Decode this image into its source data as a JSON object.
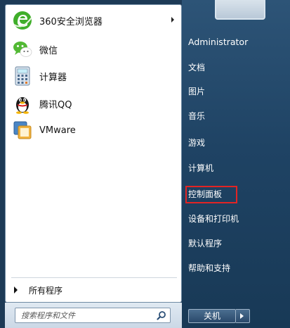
{
  "pinned_programs": [
    {
      "label": "360安全浏览器",
      "icon": "360-browser-icon",
      "has_submenu": true
    },
    {
      "label": "微信",
      "icon": "wechat-icon",
      "has_submenu": false
    },
    {
      "label": "计算器",
      "icon": "calculator-icon",
      "has_submenu": false
    },
    {
      "label": "腾讯QQ",
      "icon": "qq-penguin-icon",
      "has_submenu": false
    },
    {
      "label": "VMware",
      "icon": "vmware-icon",
      "has_submenu": false
    }
  ],
  "all_programs_label": "所有程序",
  "search": {
    "placeholder": "搜索程序和文件"
  },
  "right_links": {
    "username": "Administrator",
    "documents": "文档",
    "pictures": "图片",
    "music": "音乐",
    "games": "游戏",
    "computer": "计算机",
    "control_panel": "控制面板",
    "devices_printers": "设备和打印机",
    "default_programs": "默认程序",
    "help_support": "帮助和支持"
  },
  "highlighted_item": "控制面板",
  "highlight_color": "#e22424",
  "shutdown": {
    "label": "关机"
  },
  "colors": {
    "right_pane": "#1f4364",
    "left_pane": "#ffffff"
  }
}
